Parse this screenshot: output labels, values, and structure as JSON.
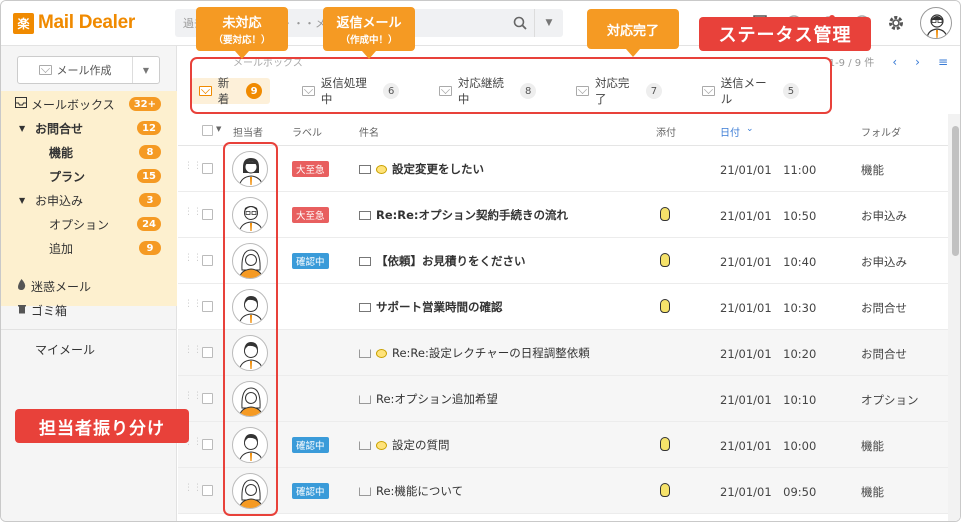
{
  "app": {
    "logo_mark": "楽",
    "logo_text": "Mail Dealer"
  },
  "search": {
    "placeholder": "過去のメール、件名・・・メール・電話を検索"
  },
  "compose": {
    "label": "メール作成"
  },
  "sidebar": {
    "items": [
      {
        "label": "メールボックス",
        "badge": "32+"
      },
      {
        "label": "お問合せ",
        "badge": "12"
      },
      {
        "label": "機能",
        "badge": "8"
      },
      {
        "label": "プラン",
        "badge": "15"
      },
      {
        "label": "お申込み",
        "badge": "3"
      },
      {
        "label": "オプション",
        "badge": "24"
      },
      {
        "label": "追加",
        "badge": "9"
      },
      {
        "label": "迷惑メール"
      },
      {
        "label": "ゴミ箱"
      },
      {
        "label": "マイメール"
      }
    ]
  },
  "main": {
    "breadcrumb": "メールボックス",
    "pager": "1-9 / 9 件",
    "tabs": [
      {
        "label": "新着",
        "count": "9"
      },
      {
        "label": "返信処理中",
        "count": "6"
      },
      {
        "label": "対応継続中",
        "count": "8"
      },
      {
        "label": "対応完了",
        "count": "7"
      },
      {
        "label": "送信メール",
        "count": "5"
      }
    ],
    "columns": {
      "assignee": "担当者",
      "label": "ラベル",
      "subject": "件名",
      "attachment": "添付",
      "date": "日付",
      "folder": "フォルダ"
    },
    "rows": [
      {
        "label": "大至急",
        "label_color": "#e85f5f",
        "subject": "設定変更をしたい",
        "date": "21/01/01　11:00",
        "folder": "機能",
        "unread": true,
        "comment": true,
        "attach": false,
        "avatar": "woman"
      },
      {
        "label": "大至急",
        "label_color": "#e85f5f",
        "subject": "Re:Re:オプション契約手続きの流れ",
        "date": "21/01/01　10:50",
        "folder": "お申込み",
        "unread": true,
        "comment": false,
        "attach": true,
        "avatar": "man-glasses"
      },
      {
        "label": "確認中",
        "label_color": "#3a9bd9",
        "subject": "【依頼】お見積りをください",
        "date": "21/01/01　10:40",
        "folder": "お申込み",
        "unread": true,
        "comment": false,
        "attach": true,
        "avatar": "woman-long"
      },
      {
        "label": "",
        "label_color": "",
        "subject": "サポート営業時間の確認",
        "date": "21/01/01　10:30",
        "folder": "お問合せ",
        "unread": true,
        "comment": false,
        "attach": true,
        "avatar": "man"
      },
      {
        "label": "",
        "label_color": "",
        "subject": "Re:Re:設定レクチャーの日程調整依頼",
        "date": "21/01/01　10:20",
        "folder": "お問合せ",
        "unread": false,
        "comment": true,
        "attach": false,
        "avatar": "man"
      },
      {
        "label": "",
        "label_color": "",
        "subject": "Re:オプション追加希望",
        "date": "21/01/01　10:10",
        "folder": "オプション",
        "unread": false,
        "comment": false,
        "attach": false,
        "avatar": "woman-long"
      },
      {
        "label": "確認中",
        "label_color": "#3a9bd9",
        "subject": "設定の質問",
        "date": "21/01/01　10:00",
        "folder": "機能",
        "unread": false,
        "comment": true,
        "attach": true,
        "avatar": "man"
      },
      {
        "label": "確認中",
        "label_color": "#3a9bd9",
        "subject": "Re:機能について",
        "date": "21/01/01　09:50",
        "folder": "機能",
        "unread": false,
        "comment": false,
        "attach": true,
        "avatar": "woman-long"
      }
    ]
  },
  "callouts": {
    "unhandled": {
      "title": "未対応",
      "sub": "（要対応！）"
    },
    "replying": {
      "title": "返信メール",
      "sub": "（作成中！）"
    },
    "done": {
      "title": "対応完了"
    },
    "status": "ステータス管理",
    "assign": "担当者振り分け"
  },
  "colors": {
    "brand": "#f08a00",
    "callout": "#f59a23",
    "highlight": "#e8413a"
  }
}
